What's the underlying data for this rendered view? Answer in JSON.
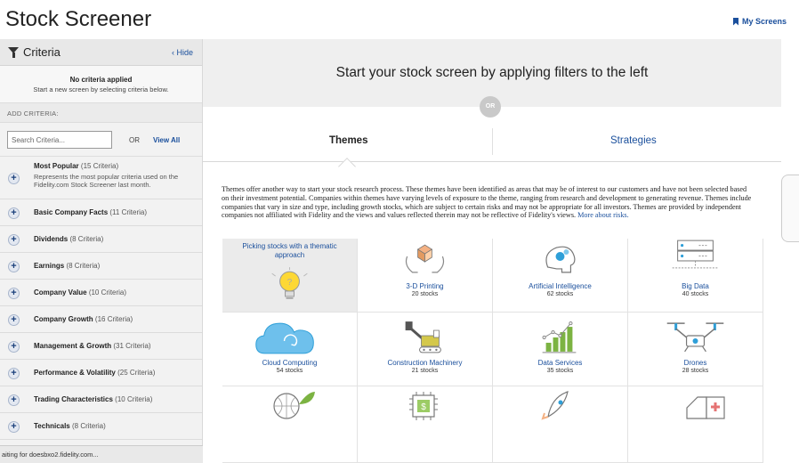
{
  "header": {
    "title": "Stock Screener",
    "my_screens": "My Screens"
  },
  "sidebar": {
    "criteria_label": "Criteria",
    "hide_label": "Hide",
    "no_criteria_title": "No criteria applied",
    "no_criteria_sub": "Start a new screen by selecting criteria below.",
    "add_criteria": "ADD CRITERIA:",
    "search_placeholder": "Search Criteria...",
    "or": "OR",
    "view_all": "View All",
    "items": [
      {
        "name": "Most Popular",
        "count": "(15 Criteria)",
        "desc": "Represents the most popular criteria used on the Fidelity.com Stock Screener last month."
      },
      {
        "name": "Basic Company Facts",
        "count": "(11 Criteria)"
      },
      {
        "name": "Dividends",
        "count": "(8 Criteria)"
      },
      {
        "name": "Earnings",
        "count": "(8 Criteria)"
      },
      {
        "name": "Company Value",
        "count": "(10 Criteria)"
      },
      {
        "name": "Company Growth",
        "count": "(16 Criteria)"
      },
      {
        "name": "Management & Growth",
        "count": "(31 Criteria)"
      },
      {
        "name": "Performance & Volatility",
        "count": "(25 Criteria)"
      },
      {
        "name": "Trading Characteristics",
        "count": "(10 Criteria)"
      },
      {
        "name": "Technicals",
        "count": "(8 Criteria)"
      }
    ]
  },
  "status_bar": "aiting for doesbxo2.fidelity.com...",
  "main": {
    "headline": "Start your stock screen by applying filters to the left",
    "or_label": "OR",
    "tabs": [
      {
        "label": "Themes",
        "active": true
      },
      {
        "label": "Strategies",
        "active": false
      }
    ],
    "description": "Themes offer another way to start your stock research process. These themes have been identified as areas that may be of interest to our customers and have not been selected based on their investment potential. Companies within themes have varying levels of exposure to the theme, ranging from research and development to generating revenue. Themes include companies that vary in size and type, including growth stocks, which are subject to certain risks and may not be appropriate for all investors. Themes are provided by independent companies not affiliated with Fidelity and the views and values reflected therein may not be reflective of Fidelity's views.",
    "risks_link": "More about risks.",
    "featured_tile": {
      "label": "Picking stocks with a thematic approach",
      "icon": "lightbulb-icon"
    },
    "themes": [
      {
        "name": "3-D Printing",
        "count": "20 stocks",
        "icon": "3d-printing-icon"
      },
      {
        "name": "Artificial Intelligence",
        "count": "62 stocks",
        "icon": "ai-brain-icon"
      },
      {
        "name": "Big Data",
        "count": "40 stocks",
        "icon": "servers-icon"
      },
      {
        "name": "Cloud Computing",
        "count": "54 stocks",
        "icon": "cloud-icon"
      },
      {
        "name": "Construction Machinery",
        "count": "21 stocks",
        "icon": "crane-icon"
      },
      {
        "name": "Data Services",
        "count": "35 stocks",
        "icon": "bar-chart-icon"
      },
      {
        "name": "Drones",
        "count": "28 stocks",
        "icon": "drone-icon"
      }
    ]
  },
  "colors": {
    "link": "#1a4f9c",
    "sidebar_bg": "#f2f2f2",
    "banner_bg": "#efefef",
    "icon_teal": "#2e9fd8",
    "icon_green": "#7cb342",
    "icon_yellow": "#fdd835"
  }
}
